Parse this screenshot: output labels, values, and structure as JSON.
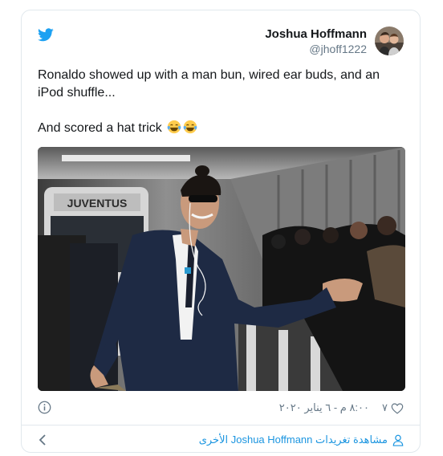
{
  "author": {
    "display_name": "Joshua Hoffmann",
    "handle": "@jhoff1222"
  },
  "tweet": {
    "line1": "Ronaldo showed up with a man bun, wired ear buds, and an iPod shuffle...",
    "line2": "And scored a hat trick"
  },
  "meta": {
    "like_count": "٧",
    "timestamp": "٨:٠٠ م - ٦ يناير ٢٠٢٠"
  },
  "footer": {
    "more_tweets": "مشاهدة تغريدات Joshua Hoffmann الأخرى"
  },
  "icons": {
    "brand": "twitter-bird-icon",
    "info": "info-icon",
    "like": "heart-icon",
    "more": "person-icon",
    "back": "chevron-left-icon"
  },
  "colors": {
    "twitter_blue": "#1da1f2",
    "link_blue": "#1b95e0",
    "text": "#14171a",
    "muted": "#657786",
    "border": "#e1e8ed"
  }
}
